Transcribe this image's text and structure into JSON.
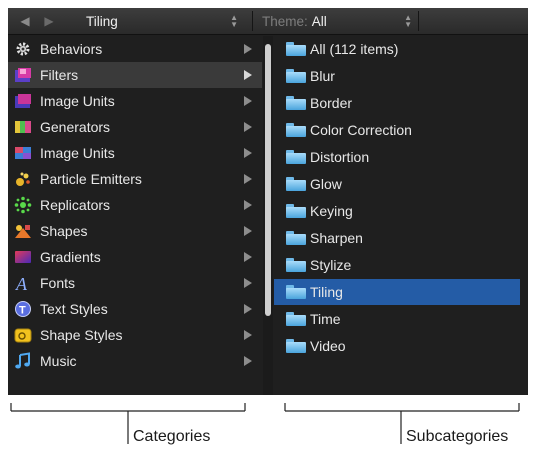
{
  "toolbar": {
    "category_value": "Tiling",
    "theme_label": "Theme:",
    "theme_value": "All"
  },
  "categories": [
    {
      "label": "Behaviors",
      "icon": "gear-icon"
    },
    {
      "label": "Filters",
      "icon": "filters-icon",
      "selected": true
    },
    {
      "label": "Image Units",
      "icon": "image-units-icon"
    },
    {
      "label": "Generators",
      "icon": "generators-icon"
    },
    {
      "label": "Image Units",
      "icon": "image-units-color-icon"
    },
    {
      "label": "Particle Emitters",
      "icon": "particle-emitters-icon"
    },
    {
      "label": "Replicators",
      "icon": "replicators-icon"
    },
    {
      "label": "Shapes",
      "icon": "shapes-icon"
    },
    {
      "label": "Gradients",
      "icon": "gradients-icon"
    },
    {
      "label": "Fonts",
      "icon": "fonts-icon"
    },
    {
      "label": "Text Styles",
      "icon": "text-styles-icon"
    },
    {
      "label": "Shape Styles",
      "icon": "shape-styles-icon"
    },
    {
      "label": "Music",
      "icon": "music-icon"
    }
  ],
  "subcategories": [
    {
      "label": "All (112 items)"
    },
    {
      "label": "Blur"
    },
    {
      "label": "Border"
    },
    {
      "label": "Color Correction"
    },
    {
      "label": "Distortion"
    },
    {
      "label": "Glow"
    },
    {
      "label": "Keying"
    },
    {
      "label": "Sharpen"
    },
    {
      "label": "Stylize"
    },
    {
      "label": "Tiling",
      "selected": true
    },
    {
      "label": "Time"
    },
    {
      "label": "Video"
    }
  ],
  "callouts": {
    "categories": "Categories",
    "subcategories": "Subcategories"
  },
  "colors": {
    "panel_bg": "#1f1f1f",
    "selected_category_bg": "#3a3a3a",
    "selected_subcategory_bg": "#245ca6",
    "folder_blue": "#6fb9e8"
  }
}
